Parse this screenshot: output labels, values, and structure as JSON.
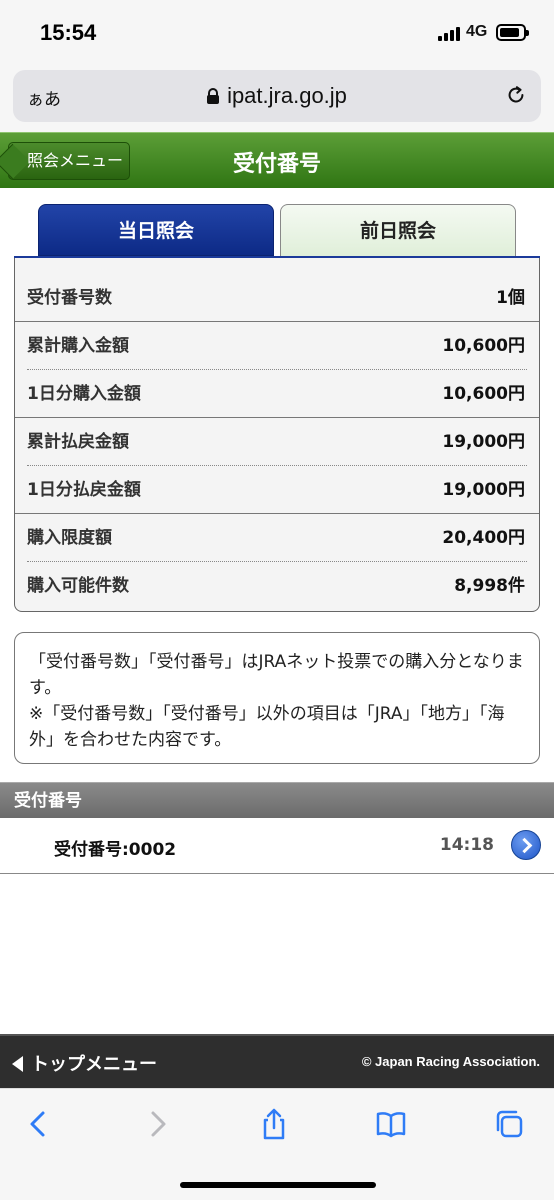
{
  "status_bar": {
    "time": "15:54",
    "network": "4G"
  },
  "browser": {
    "aa_label": "ぁあ",
    "url": "ipat.jra.go.jp"
  },
  "header": {
    "back_label": "照会メニュー",
    "title": "受付番号"
  },
  "tabs": [
    {
      "label": "当日照会",
      "active": true
    },
    {
      "label": "前日照会",
      "active": false
    }
  ],
  "summary": {
    "rows": [
      {
        "label": "受付番号数",
        "value": "1個"
      },
      {
        "label": "累計購入金額",
        "value": "10,600円"
      },
      {
        "label": "1日分購入金額",
        "value": "10,600円"
      },
      {
        "label": "累計払戻金額",
        "value": "19,000円"
      },
      {
        "label": "1日分払戻金額",
        "value": "19,000円"
      },
      {
        "label": "購入限度額",
        "value": "20,400円"
      },
      {
        "label": "購入可能件数",
        "value": "8,998件"
      }
    ]
  },
  "note": {
    "line1": "「受付番号数」「受付番号」はJRAネット投票での購入分となります。",
    "line2": "※「受付番号数」「受付番号」以外の項目は「JRA」「地方」「海外」を合わせた内容です。"
  },
  "receipt_section": {
    "title": "受付番号",
    "items": [
      {
        "label": "受付番号:0002",
        "time": "14:18"
      }
    ]
  },
  "footer": {
    "top_menu_label": "トップメニュー",
    "copyright": "© Japan Racing Association."
  },
  "colors": {
    "header_green": "#3f861f",
    "tab_blue": "#1b3a9a",
    "footer_dark": "#2e2e2e",
    "ios_blue": "#2f7cf6"
  }
}
